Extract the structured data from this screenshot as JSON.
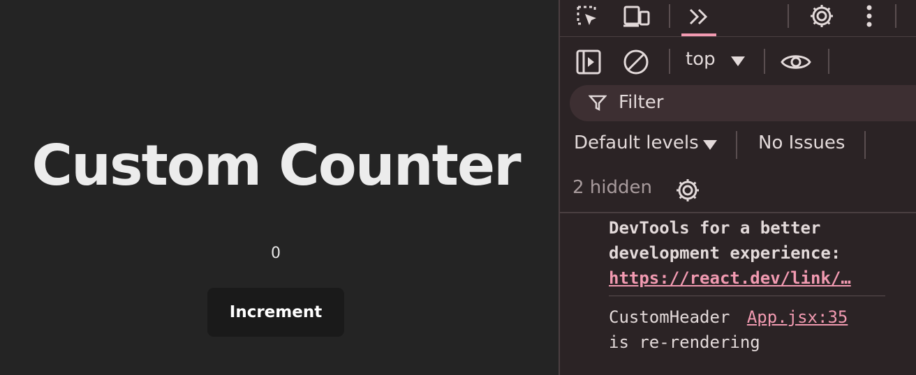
{
  "app": {
    "title": "Custom Counter",
    "count": "0",
    "increment_label": "Increment"
  },
  "devtools": {
    "tabs": {
      "inspect_icon": "inspect-element-icon",
      "device_icon": "device-toolbar-icon",
      "more_tabs_icon": "more-tabs-chevron-icon",
      "settings_icon": "gear-icon",
      "menu_icon": "kebab-menu-icon"
    },
    "toolbar": {
      "context": "top",
      "sidebar_icon": "sidebar-toggle-icon",
      "clear_icon": "clear-console-icon",
      "eye_icon": "live-expression-eye-icon"
    },
    "filter_placeholder": "Filter",
    "levels_label": "Default levels",
    "issues_label": "No Issues",
    "hidden_label": "2 hidden",
    "messages": [
      {
        "line1": "DevTools for a better",
        "line2": "development experience:",
        "link": "https://react.dev/link/…"
      },
      {
        "text": "CustomHeader",
        "source": "App.jsx:35",
        "line2": "is re-rendering"
      }
    ],
    "accent_color": "#f29ab1"
  }
}
